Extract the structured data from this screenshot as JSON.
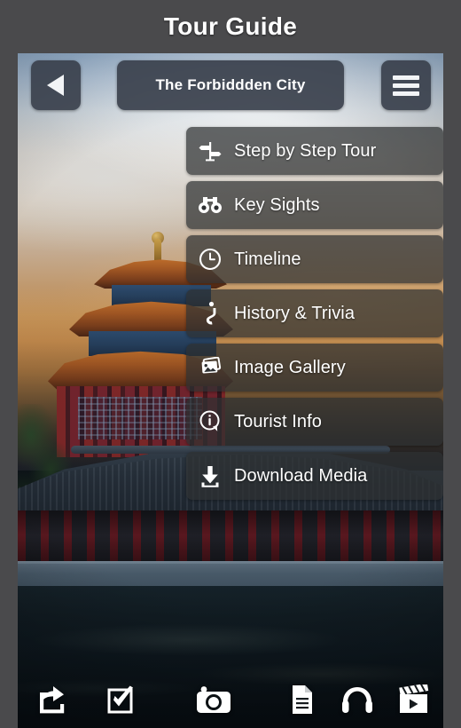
{
  "app": {
    "title": "Tour Guide"
  },
  "topbar": {
    "back_label": "Back",
    "back_icon": "back-triangle-icon",
    "place_title": "The Forbiddden City",
    "menu_label": "Menu",
    "menu_icon": "hamburger-icon"
  },
  "menu": {
    "items": [
      {
        "label": "Step by Step Tour",
        "icon": "signpost-icon"
      },
      {
        "label": "Key Sights",
        "icon": "binoculars-icon"
      },
      {
        "label": "Timeline",
        "icon": "clock-icon"
      },
      {
        "label": "History & Trivia",
        "icon": "inverted-question-mark-icon"
      },
      {
        "label": "Image Gallery",
        "icon": "photo-stack-icon"
      },
      {
        "label": "Tourist Info",
        "icon": "info-bubble-icon"
      },
      {
        "label": "Download Media",
        "icon": "download-arrow-icon"
      }
    ]
  },
  "toolbar": {
    "items": [
      {
        "label": "Share",
        "icon": "share-icon"
      },
      {
        "label": "Checklist",
        "icon": "checkbox-check-icon"
      },
      {
        "label": "Camera",
        "icon": "camera-icon"
      },
      {
        "label": "Document",
        "icon": "document-icon"
      },
      {
        "label": "Audio",
        "icon": "headphones-icon"
      },
      {
        "label": "Video",
        "icon": "clapperboard-icon"
      }
    ]
  },
  "theme": {
    "frame": "#4a4a4c",
    "chrome": "#3a404c",
    "menu_item": "rgba(46,48,50,0.72)",
    "text": "#ffffff"
  }
}
